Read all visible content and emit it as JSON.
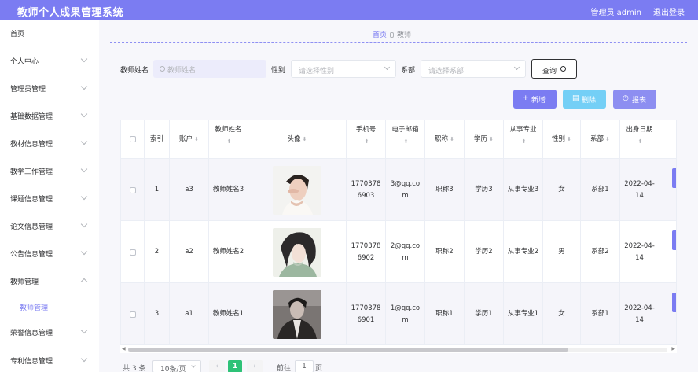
{
  "header": {
    "title": "教师个人成果管理系统",
    "user": "管理员 admin",
    "logout": "退出登录"
  },
  "sidebar": {
    "items": [
      {
        "label": "首页"
      },
      {
        "label": "个人中心"
      },
      {
        "label": "管理员管理"
      },
      {
        "label": "基础数据管理"
      },
      {
        "label": "教材信息管理"
      },
      {
        "label": "教学工作管理"
      },
      {
        "label": "课题信息管理"
      },
      {
        "label": "论文信息管理"
      },
      {
        "label": "公告信息管理"
      },
      {
        "label": "教师管理"
      },
      {
        "label": "教师管理"
      },
      {
        "label": "荣誉信息管理"
      },
      {
        "label": "专利信息管理"
      }
    ]
  },
  "breadcrumb": {
    "home": "首页",
    "current": "教师"
  },
  "filters": {
    "name_label": "教师姓名",
    "name_placeholder": "教师姓名",
    "gender_label": "性别",
    "gender_placeholder": "请选择性别",
    "dept_label": "系部",
    "dept_placeholder": "请选择系部",
    "query_label": "查询"
  },
  "actions": {
    "add": "新增",
    "delete": "删除",
    "report": "报表"
  },
  "table": {
    "columns": [
      "索引",
      "账户",
      "教师姓名",
      "头像",
      "手机号",
      "电子邮箱",
      "职称",
      "学历",
      "从事专业",
      "性别",
      "系部",
      "出身日期"
    ],
    "rows": [
      {
        "index": "1",
        "account": "a3",
        "name": "教师姓名3",
        "phone": "17703786903",
        "email": "3@qq.com",
        "title": "职称3",
        "edu": "学历3",
        "major": "从事专业3",
        "gender": "女",
        "dept": "系部1",
        "birth": "2022-04-14"
      },
      {
        "index": "2",
        "account": "a2",
        "name": "教师姓名2",
        "phone": "17703786902",
        "email": "2@qq.com",
        "title": "职称2",
        "edu": "学历2",
        "major": "从事专业2",
        "gender": "男",
        "dept": "系部2",
        "birth": "2022-04-14"
      },
      {
        "index": "3",
        "account": "a1",
        "name": "教师姓名1",
        "phone": "17703786901",
        "email": "1@qq.com",
        "title": "职称1",
        "edu": "学历1",
        "major": "从事专业1",
        "gender": "女",
        "dept": "系部1",
        "birth": "2022-04-14"
      }
    ]
  },
  "pager": {
    "total": "共 3 条",
    "size": "10条/页",
    "page": "1",
    "goto": "前往",
    "goto_value": "1",
    "unit": "页"
  },
  "colors": {
    "accent": "#7b7cf2",
    "delete": "#74cff6",
    "page_active": "#2ec277"
  }
}
